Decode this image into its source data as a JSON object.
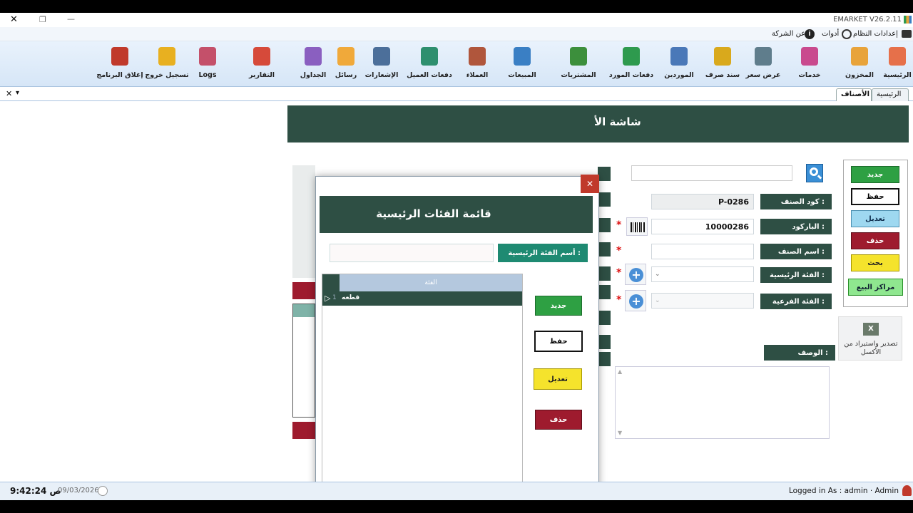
{
  "window": {
    "title": "EMARKET V26.2.11",
    "close_glyph": "✕",
    "restore_glyph": "❐",
    "minimize_glyph": "—"
  },
  "menubar": {
    "items": [
      "إعدادات النظام",
      "أدوات",
      "عن الشركة"
    ]
  },
  "ribbon": {
    "items": [
      {
        "label": "الرئيسية",
        "icon": "home-icon",
        "color": "#e6704a"
      },
      {
        "label": "المخزون",
        "icon": "inventory-icon",
        "color": "#e8a33a"
      },
      {
        "label": "خدمات",
        "icon": "services-icon",
        "color": "#c94a8e"
      },
      {
        "label": "عرض سعر",
        "icon": "quote-icon",
        "color": "#5f7d8c"
      },
      {
        "label": "سند صرف",
        "icon": "voucher-icon",
        "color": "#d9a91c"
      },
      {
        "label": "الموردين",
        "icon": "suppliers-icon",
        "color": "#4a78b8"
      },
      {
        "label": "دفعات المورد",
        "icon": "supplier-payments-icon",
        "color": "#2e9a4e"
      },
      {
        "label": "المشتريات",
        "icon": "purchases-icon",
        "color": "#3c8f3c"
      },
      {
        "label": "المبيعات",
        "icon": "sales-icon",
        "color": "#3a7fc4"
      },
      {
        "label": "العملاء",
        "icon": "customers-icon",
        "color": "#b0563c"
      },
      {
        "label": "دفعات العميل",
        "icon": "customer-payments-icon",
        "color": "#2e8f6e"
      },
      {
        "label": "الإشعارات",
        "icon": "notifications-icon",
        "color": "#4c6f9a"
      },
      {
        "label": "رسائل",
        "icon": "sms-icon",
        "color": "#f0a93a"
      },
      {
        "label": "الجداول",
        "icon": "tables-icon",
        "color": "#8a5fc0"
      },
      {
        "label": "التقارير",
        "icon": "reports-icon",
        "color": "#d64a3a"
      },
      {
        "label": "Logs",
        "icon": "logs-icon",
        "color": "#c4506a"
      },
      {
        "label": "تسجيل خروج",
        "icon": "logout-lock-icon",
        "color": "#e8b020"
      },
      {
        "label": "إغلاق البرنامج",
        "icon": "exit-icon",
        "color": "#c0392b"
      }
    ]
  },
  "tabs": {
    "home": "الرئيسية",
    "items": "الأصناف",
    "close_glyph": "✕",
    "dropdown_glyph": "▾"
  },
  "screen": {
    "title": "شاشة الأ"
  },
  "side_buttons": {
    "new": "جديد",
    "save": "حفظ",
    "edit": "تعديل",
    "delete": "حذف",
    "search": "بحث",
    "sales_centers": "مراكز البيع"
  },
  "form": {
    "item_code_label": "كود الصنف :",
    "item_code_value": "P-0286",
    "barcode_label": "الباركود :",
    "barcode_value": "10000286",
    "item_name_label": "اسم الصنف :",
    "main_category_label": "الفئة الرئيسية :",
    "sub_category_label": "الفئة الفرعية :",
    "description_label": "الوصف :",
    "required_mark": "*",
    "add_glyph": "+"
  },
  "excel": {
    "label": "تصدير واستيراد من الأكسل"
  },
  "dialog": {
    "title": "قائمة الفئات الرئيسية",
    "name_label": "أسم الفئة الرئيسية :",
    "name_value": "",
    "grid_header": "الفئة",
    "rows": [
      {
        "num": "1",
        "name": "قطعه"
      }
    ],
    "row_pointer": "▷",
    "buttons": {
      "new": "جديد",
      "save": "حفظ",
      "edit": "تعديل",
      "delete": "حذف"
    },
    "close_glyph": "✕"
  },
  "status": {
    "time": "9:42:24 ص",
    "date": "09/03/2026",
    "logged_in": "Logged in As :  admin  ·  Admin"
  }
}
